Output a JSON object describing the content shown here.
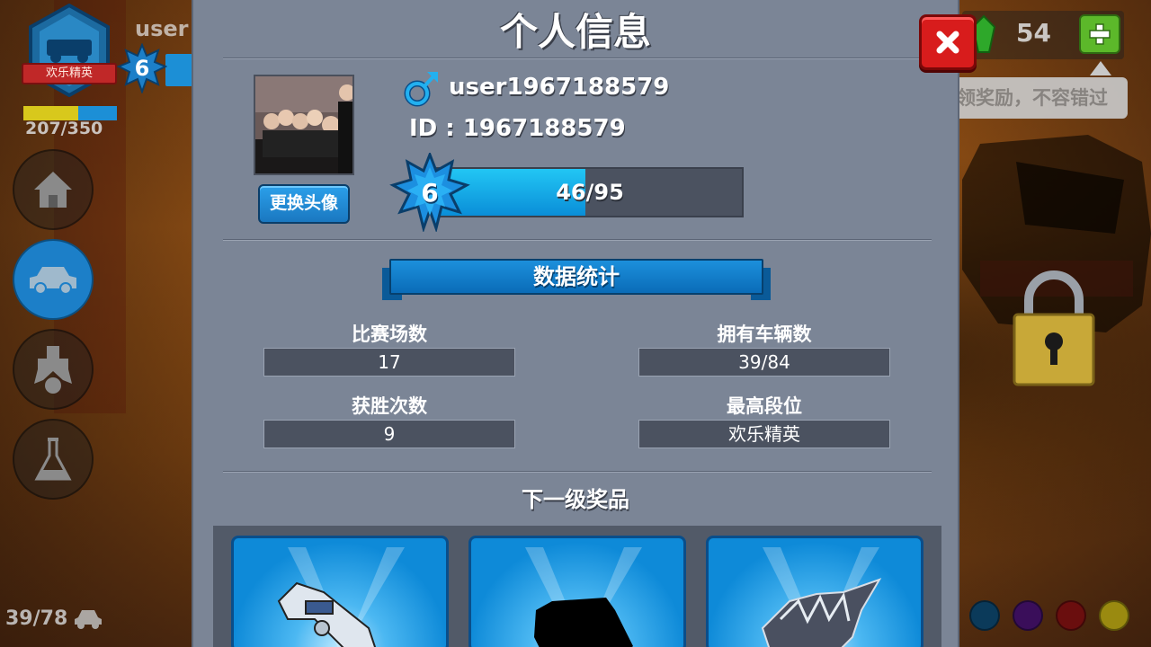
{
  "hud": {
    "rank_label": "欢乐精英",
    "username_partial": "user",
    "level": "6",
    "xp_text": "207/350",
    "car_count": "39/78",
    "gems": "54",
    "tip_text": "领奖励，不容错过"
  },
  "dialog": {
    "title": "个人信息",
    "change_avatar_label": "更换头像",
    "username": "user1967188579",
    "id_line": "ID : 1967188579",
    "level": "6",
    "xp_text": "46/95",
    "xp_fraction": 0.484,
    "stats_title": "数据统计",
    "stats": [
      {
        "label": "比赛场数",
        "value": "17"
      },
      {
        "label": "拥有车辆数",
        "value": "39/84"
      },
      {
        "label": "获胜次数",
        "value": "9"
      },
      {
        "label": "最高段位",
        "value": "欢乐精英"
      }
    ],
    "reward_title": "下一级奖品"
  },
  "colors": {
    "panel": "#7b8596",
    "accent_blue": "#1c90dc",
    "close_red": "#d81c1c",
    "gem_green": "#5cb82a"
  },
  "paint_colors": [
    "#0b3a5a",
    "#3a0e5a",
    "#6a0e0e",
    "#9a8a10"
  ]
}
